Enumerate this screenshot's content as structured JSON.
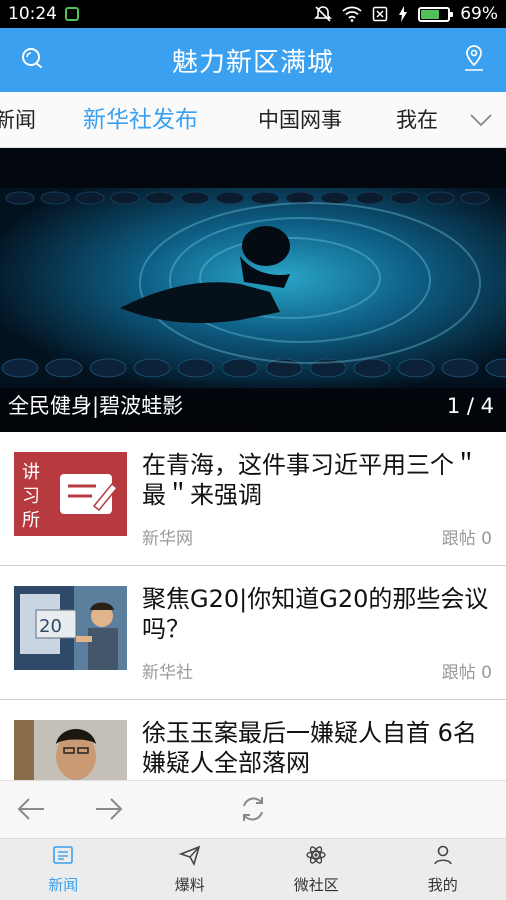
{
  "status_bar": {
    "time": "10:24",
    "battery_text": "69%",
    "battery_level": 0.69,
    "icons": [
      "notifications-muted-icon",
      "wifi-icon",
      "no-sim-icon",
      "charging-icon",
      "battery-icon"
    ]
  },
  "app_bar": {
    "title": "魅力新区满城",
    "left_icon": "chat-bubble-icon",
    "right_icon": "location-pin-icon",
    "accent": "#3aa0ef"
  },
  "tabs": {
    "items": [
      {
        "label": "新闻"
      },
      {
        "label": "新华社发布",
        "active": true
      },
      {
        "label": "中国网事"
      },
      {
        "label": "我在"
      }
    ],
    "more_icon": "chevron-down-icon"
  },
  "banner": {
    "caption": "全民健身|碧波蛙影",
    "pager": "1 / 4"
  },
  "news": [
    {
      "headline": "在青海，这件事习近平用三个＂最＂来强调",
      "source": "新华网",
      "replies": "跟帖 0",
      "thumb": "讲习所"
    },
    {
      "headline": "聚焦G20|你知道G20的那些会议吗？",
      "source": "新华社",
      "replies": "跟帖 0",
      "thumb": "G20"
    },
    {
      "headline": "徐玉玉案最后一嫌疑人自首 6名嫌疑人全部落网",
      "source": "",
      "replies": ""
    }
  ],
  "toolbar": {
    "icons": [
      "back-arrow-icon",
      "forward-arrow-icon",
      "refresh-icon"
    ]
  },
  "bottom_nav": [
    {
      "label": "新闻",
      "icon": "news-icon",
      "active": true
    },
    {
      "label": "爆料",
      "icon": "paper-plane-icon"
    },
    {
      "label": "微社区",
      "icon": "atom-icon"
    },
    {
      "label": "我的",
      "icon": "person-icon"
    }
  ]
}
